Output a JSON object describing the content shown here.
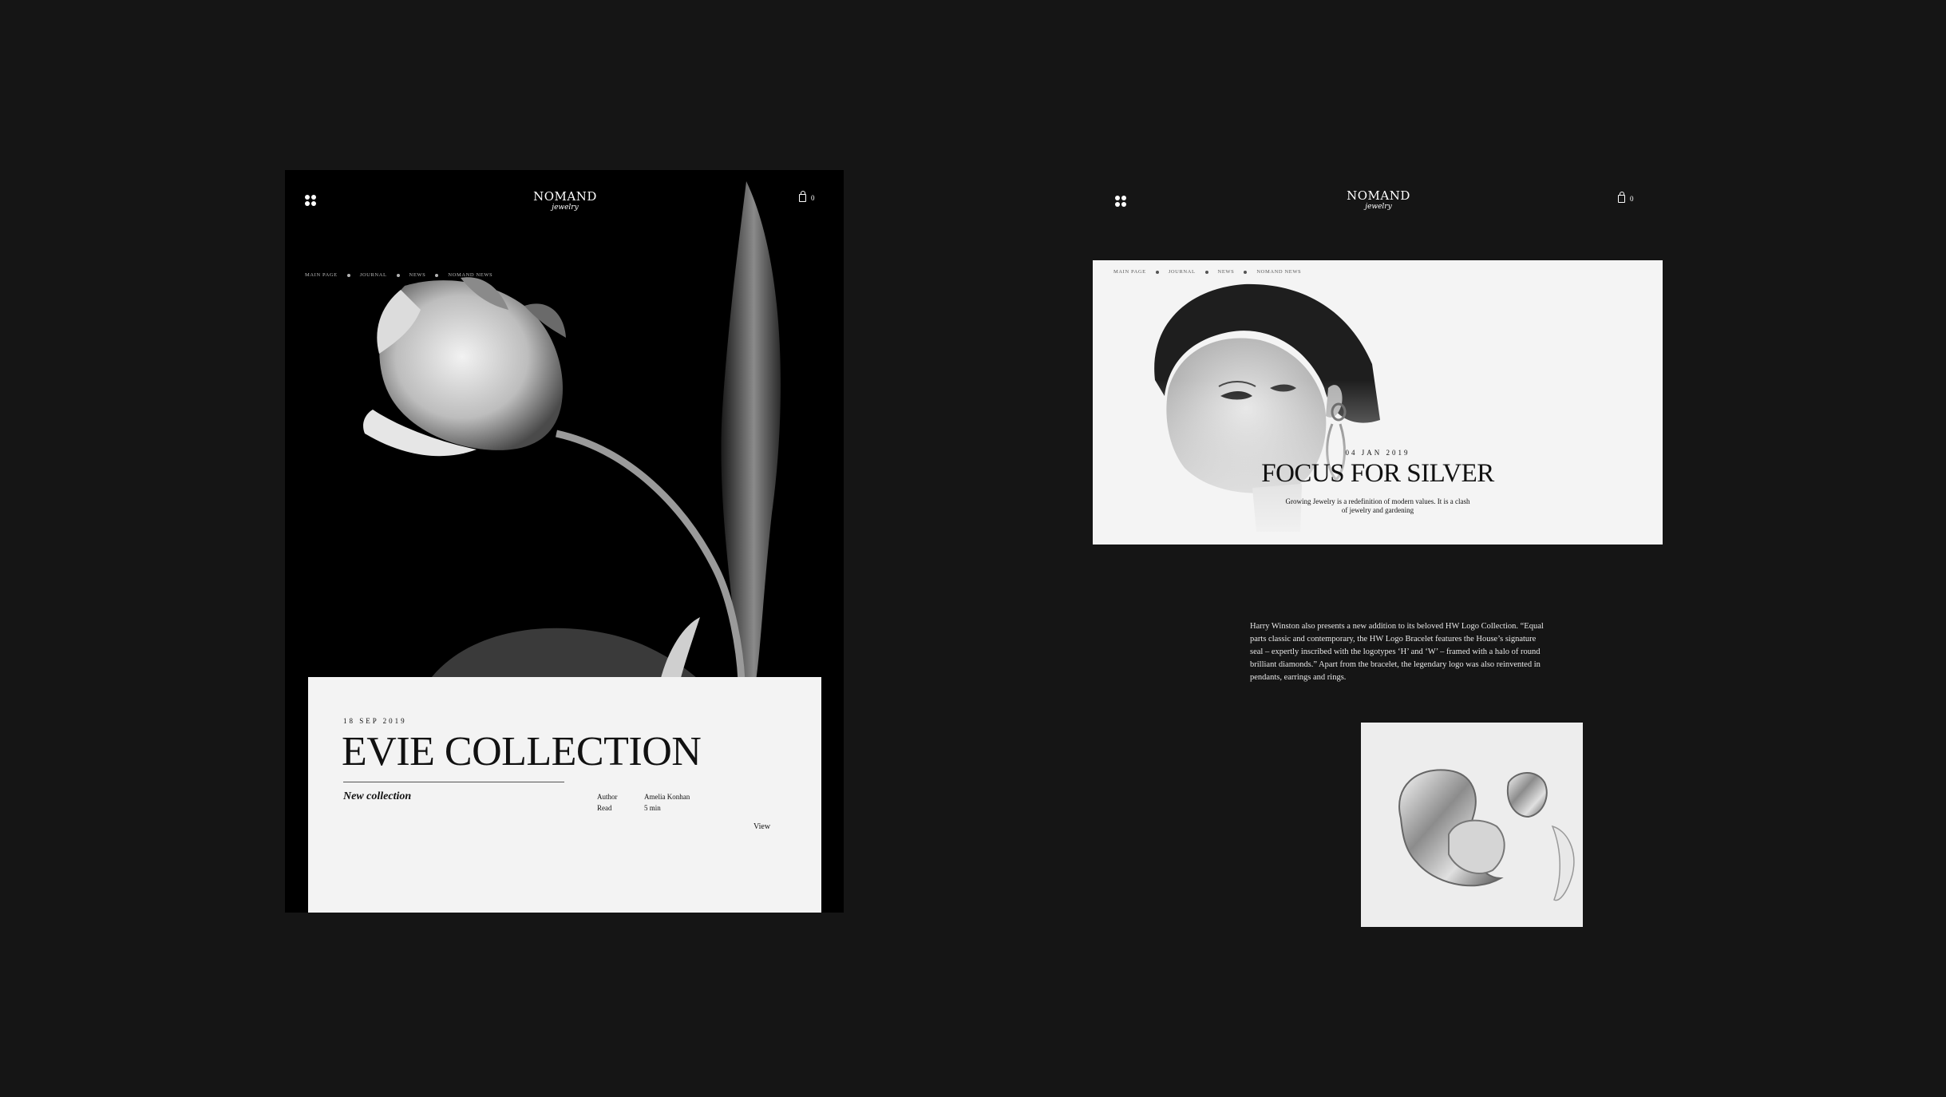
{
  "left": {
    "brand": "NOMAND",
    "brand_sub": "jewelry",
    "cart_count": "0",
    "breadcrumb": [
      "MAIN PAGE",
      "JOURNAL",
      "NEWS",
      "NOMAND NEWS"
    ],
    "hero": {
      "date": "18 SEP 2019",
      "title": "EVIE COLLECTION",
      "tagline": "New collection",
      "meta": [
        {
          "label": "Author",
          "value": "Amelia Konhan"
        },
        {
          "label": "Read",
          "value": "5 min"
        }
      ],
      "view_label": "View"
    }
  },
  "right": {
    "brand": "NOMAND",
    "brand_sub": "jewelry",
    "cart_count": "0",
    "breadcrumb": [
      "MAIN PAGE",
      "JOURNAL",
      "NEWS",
      "NOMAND NEWS"
    ],
    "banner": {
      "date": "04 JAN 2019",
      "title": "FOCUS FOR SILVER",
      "description": "Growing Jewelry is a redefinition of modern values. It is a clash of jewelry and gardening"
    },
    "article_text": "Harry Winston also presents a new addition to its beloved HW Logo Collection. “Equal parts classic and contemporary, the HW Logo Bracelet features the House’s signature seal – expertly inscribed with the logotypes ‘H’ and ‘W’ – framed with a halo of round brilliant diamonds.” Apart from the bracelet, the legendary logo was also reinvented in pendants, earrings and rings."
  },
  "colors": {
    "background": "#151515",
    "card_dark": "#000000",
    "panel_light": "#f3f3f3",
    "ink": "#111111"
  }
}
